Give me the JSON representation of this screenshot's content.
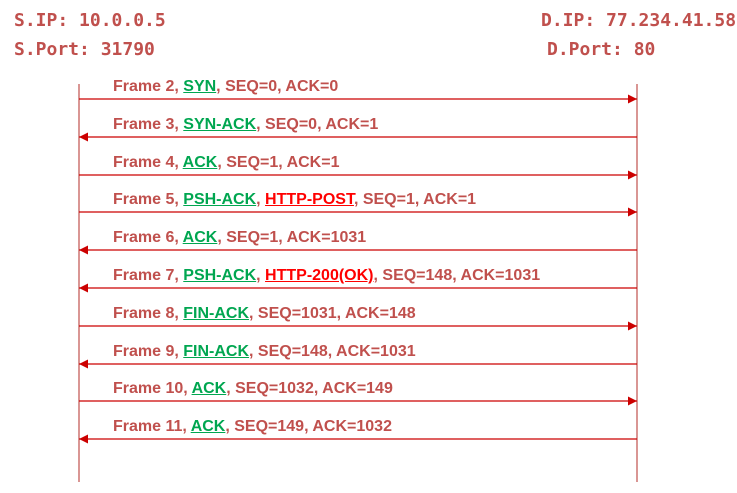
{
  "source": {
    "ip": "S.IP: 10.0.0.5",
    "port": "S.Port: 31790"
  },
  "destination": {
    "ip": "D.IP: 77.234.41.58",
    "port": "D.Port: 80"
  },
  "colors": {
    "text": "#c0504d",
    "flag": "#00a650",
    "http": "#ff0000",
    "line": "#cc0000",
    "lifeline": "#c0504d"
  },
  "messages": [
    {
      "direction": "right",
      "segments": [
        {
          "text": "Frame 2, ",
          "style": "plain"
        },
        {
          "text": "SYN",
          "style": "green"
        },
        {
          "text": ", SEQ=0, ACK=0",
          "style": "plain"
        }
      ]
    },
    {
      "direction": "left",
      "segments": [
        {
          "text": "Frame 3, ",
          "style": "plain"
        },
        {
          "text": "SYN-ACK",
          "style": "green"
        },
        {
          "text": ", SEQ=0, ACK=1",
          "style": "plain"
        }
      ]
    },
    {
      "direction": "right",
      "segments": [
        {
          "text": "Frame 4, ",
          "style": "plain"
        },
        {
          "text": "ACK",
          "style": "green"
        },
        {
          "text": ", SEQ=1, ACK=1",
          "style": "plain"
        }
      ]
    },
    {
      "direction": "right",
      "segments": [
        {
          "text": "Frame 5, ",
          "style": "plain"
        },
        {
          "text": "PSH-ACK",
          "style": "green"
        },
        {
          "text": ", ",
          "style": "plain"
        },
        {
          "text": "HTTP-POST",
          "style": "red"
        },
        {
          "text": ", SEQ=1, ACK=1",
          "style": "plain"
        }
      ]
    },
    {
      "direction": "left",
      "segments": [
        {
          "text": "Frame 6, ",
          "style": "plain"
        },
        {
          "text": "ACK",
          "style": "green"
        },
        {
          "text": ", SEQ=1, ACK=1031",
          "style": "plain"
        }
      ]
    },
    {
      "direction": "left",
      "segments": [
        {
          "text": "Frame 7, ",
          "style": "plain"
        },
        {
          "text": "PSH-ACK",
          "style": "green"
        },
        {
          "text": ", ",
          "style": "plain"
        },
        {
          "text": "HTTP-200(OK)",
          "style": "red"
        },
        {
          "text": ", SEQ=148, ACK=1031",
          "style": "plain"
        }
      ]
    },
    {
      "direction": "right",
      "segments": [
        {
          "text": "Frame 8, ",
          "style": "plain"
        },
        {
          "text": "FIN-ACK",
          "style": "green"
        },
        {
          "text": ", SEQ=1031, ACK=148",
          "style": "plain"
        }
      ]
    },
    {
      "direction": "left",
      "segments": [
        {
          "text": "Frame 9, ",
          "style": "plain"
        },
        {
          "text": "FIN-ACK",
          "style": "green"
        },
        {
          "text": ", SEQ=148, ACK=1031",
          "style": "plain"
        }
      ]
    },
    {
      "direction": "right",
      "segments": [
        {
          "text": "Frame 10, ",
          "style": "plain"
        },
        {
          "text": "ACK",
          "style": "green"
        },
        {
          "text": ", SEQ=1032, ACK=149",
          "style": "plain"
        }
      ]
    },
    {
      "direction": "left",
      "segments": [
        {
          "text": "Frame 11, ",
          "style": "plain"
        },
        {
          "text": "ACK",
          "style": "green"
        },
        {
          "text": ", SEQ=149, ACK=1032",
          "style": "plain"
        }
      ]
    }
  ]
}
